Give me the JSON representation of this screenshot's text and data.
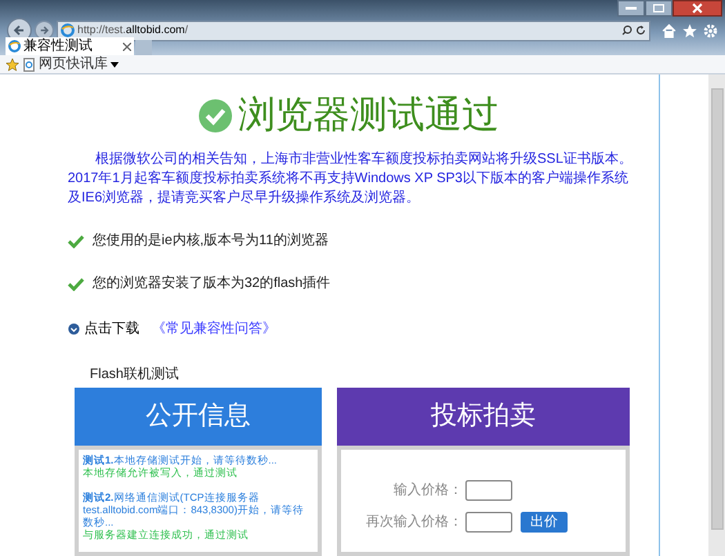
{
  "browser": {
    "url_prefix": "http://test.",
    "url_host": "alltobid.com",
    "url_suffix": "/",
    "tab": {
      "label": "兼容性测试",
      "selected": true
    },
    "favorites_item": "网页快讯库"
  },
  "page": {
    "title": "浏览器测试通过",
    "notice": "根据微软公司的相关告知，上海市非营业性客车额度投标拍卖网站将升级SSL证书版本。2017年1月起客车额度投标拍卖系统将不再支持Windows XP SP3以下版本的客户端操作系统及IE6浏览器，提请竞买客户尽早升级操作系统及浏览器。",
    "checks": [
      {
        "text": "您使用的是ie内核,版本号为11的浏览器",
        "passed": true
      },
      {
        "text": "您的浏览器安装了版本为32的flash插件",
        "passed": true
      }
    ],
    "download": {
      "label": "点击下载",
      "link": "《常见兼容性问答》"
    },
    "flash_title": "Flash联机测试",
    "public_panel": {
      "title": "公开信息",
      "log": [
        {
          "kind": "head",
          "bold": "测试1.",
          "text": "本地存储测试开始，请等待数秒..."
        },
        {
          "kind": "ok",
          "text": "本地存储允许被写入，通过测试"
        },
        {
          "kind": "gap"
        },
        {
          "kind": "head",
          "bold": "测试2.",
          "text": "网络通信测试(TCP连接服务器test.alltobid.com端口：843,8300)开始，请等待数秒..."
        },
        {
          "kind": "ok",
          "text": "与服务器建立连接成功，通过测试"
        }
      ]
    },
    "bid_panel": {
      "title": "投标拍卖",
      "fields": [
        {
          "label": "输入价格："
        },
        {
          "label": "再次输入价格："
        }
      ],
      "button": "出价"
    }
  }
}
